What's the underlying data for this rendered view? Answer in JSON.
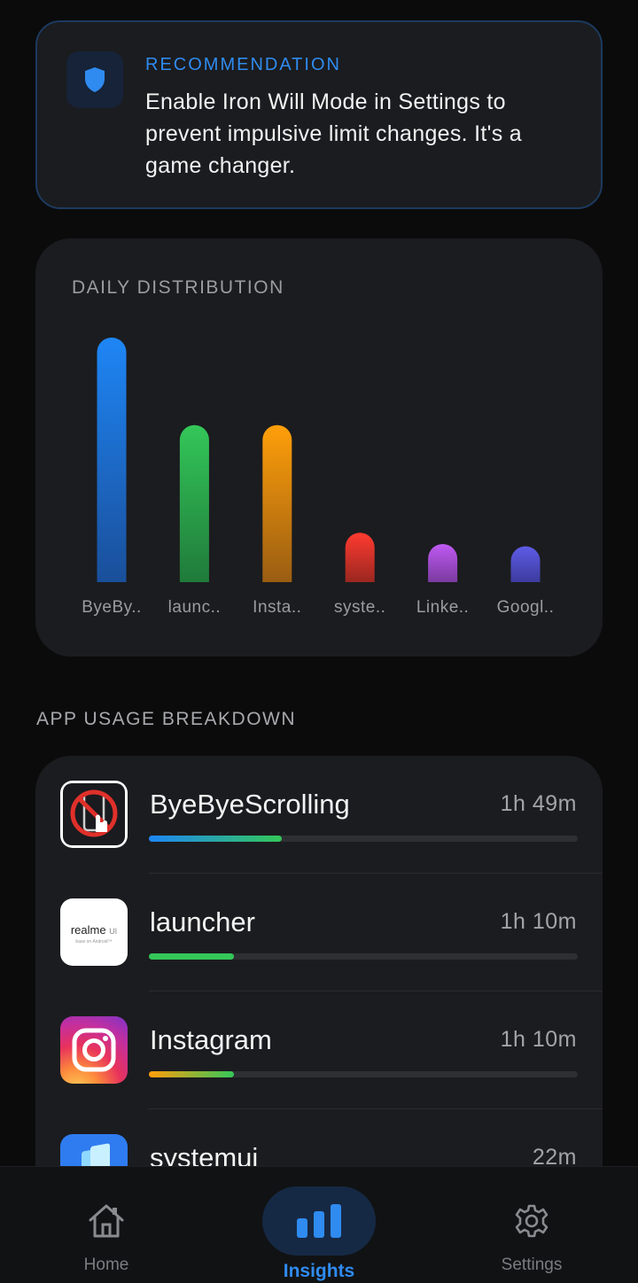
{
  "recommendation": {
    "label": "RECOMMENDATION",
    "text": "Enable Iron Will Mode in Settings to prevent impulsive limit changes. It's a game changer.",
    "icon": "shield-icon",
    "accent": "#2f8bf0"
  },
  "distribution": {
    "title": "DAILY DISTRIBUTION"
  },
  "chart_data": {
    "type": "bar",
    "title": "DAILY DISTRIBUTION",
    "categories": [
      "ByeBy..",
      "launc..",
      "Insta..",
      "syste..",
      "Linke..",
      "Googl.."
    ],
    "values": [
      109,
      70,
      70,
      22,
      17,
      16
    ],
    "colors": [
      [
        "#1e86f5",
        "#1a4f9a"
      ],
      [
        "#34c759",
        "#1f7a3a"
      ],
      [
        "#ff9f0a",
        "#9a5d12"
      ],
      [
        "#ff3b30",
        "#9a2720"
      ],
      [
        "#bf5af2",
        "#7a3aa0"
      ],
      [
        "#5e5ce6",
        "#3d3b9e"
      ]
    ],
    "ylim": [
      0,
      109
    ],
    "grid": false,
    "legend": "none"
  },
  "breakdown": {
    "heading": "APP USAGE BREAKDOWN",
    "apps": [
      {
        "name": "ByeByeScrolling",
        "time": "1h 49m",
        "fraction": 1.0,
        "icon": "no-scroll-phone-icon",
        "bar_color": "linear-gradient(90deg,#1e86f5,#34c759)"
      },
      {
        "name": "launcher",
        "time": "1h 10m",
        "fraction": 0.642,
        "icon": "realme-ui-icon",
        "icon_text": "realme",
        "icon_text2": "UI",
        "icon_sub": "base on Android™",
        "bar_color": "#34c759"
      },
      {
        "name": "Instagram",
        "time": "1h 10m",
        "fraction": 0.642,
        "icon": "instagram-icon",
        "bar_color": "linear-gradient(90deg,#ff9f0a,#34c759)"
      },
      {
        "name": "systemui",
        "time": "22m",
        "fraction": 0.2,
        "icon": "systemui-icon",
        "bar_color": "#ff3b30"
      }
    ]
  },
  "nav": {
    "items": [
      {
        "label": "Home",
        "icon": "home-icon",
        "active": false
      },
      {
        "label": "Insights",
        "icon": "bar-chart-icon",
        "active": true
      },
      {
        "label": "Settings",
        "icon": "gear-icon",
        "active": false
      }
    ]
  }
}
